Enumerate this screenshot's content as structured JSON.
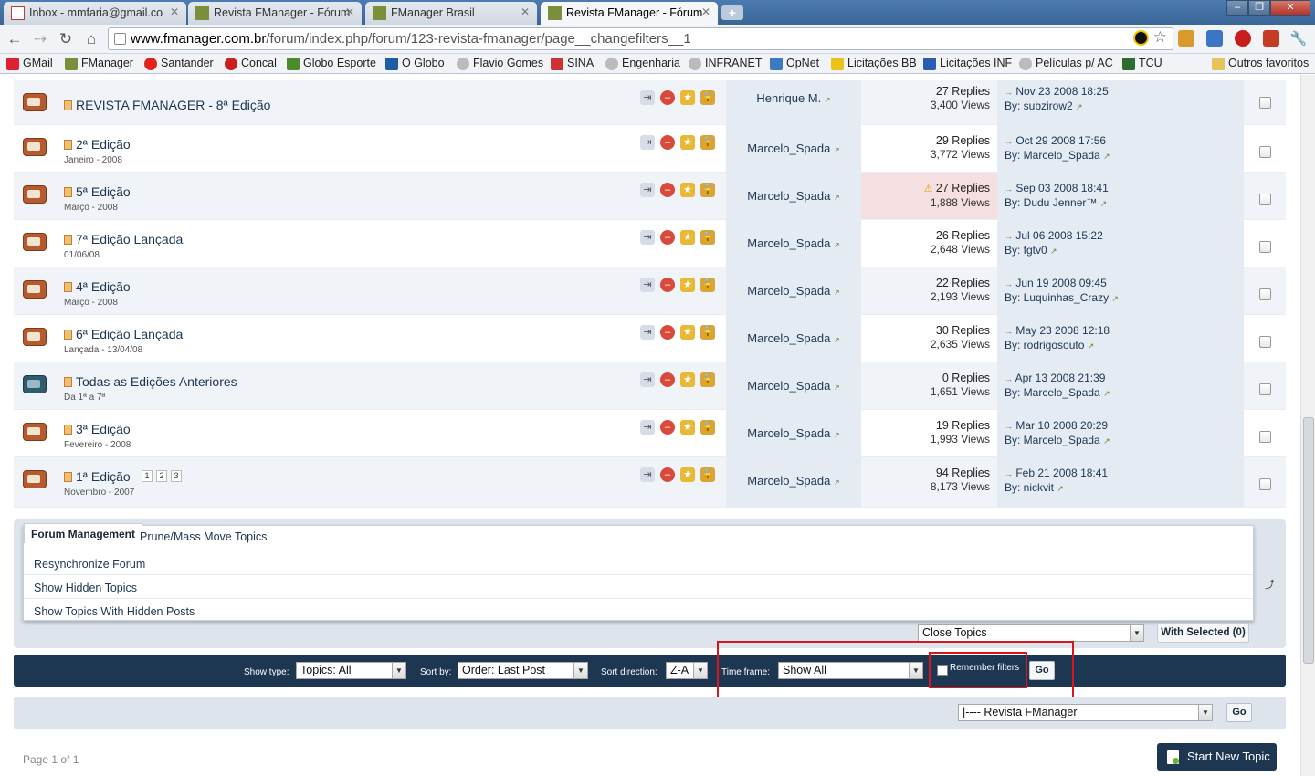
{
  "browser": {
    "tabs": [
      {
        "label": "Inbox - mmfaria@gmail.co"
      },
      {
        "label": "Revista FManager - Fórum"
      },
      {
        "label": "FManager Brasil"
      },
      {
        "label": "Revista FManager - Fórum"
      }
    ],
    "new_tab": "+",
    "url_domain": "www.fmanager.com.br",
    "url_path": "/forum/index.php/forum/123-revista-fmanager/page__changefilters__1",
    "bookmarks": [
      "GMail",
      "FManager",
      "Santander",
      "Concal",
      "Globo Esporte",
      "O Globo",
      "Flavio Gomes",
      "SINA",
      "Engenharia",
      "INFRANET",
      "OpNet",
      "Licitações BB",
      "Licitações INF",
      "Películas p/ AC",
      "TCU"
    ],
    "other_bookmarks": "Outros favoritos"
  },
  "topics": [
    {
      "title": "REVISTA FMANAGER - 8ª Edição",
      "desc": "",
      "starter": "Henrique M.",
      "replies": "27 Replies",
      "views": "3,400 Views",
      "last_date": "Nov 23 2008 18:25",
      "last_by": "By: subzirow2",
      "hot": false,
      "icon": "folder"
    },
    {
      "title": "2ª Edição",
      "desc": "Janeiro - 2008",
      "starter": "Marcelo_Spada",
      "replies": "29 Replies",
      "views": "3,772 Views",
      "last_date": "Oct 29 2008 17:56",
      "last_by": "By: Marcelo_Spada",
      "hot": false,
      "icon": "folder"
    },
    {
      "title": "5ª Edição",
      "desc": "Março - 2008",
      "starter": "Marcelo_Spada",
      "replies": "27 Replies",
      "views": "1,888 Views",
      "last_date": "Sep 03 2008 18:41",
      "last_by": "By: Dudu Jenner™",
      "hot": true,
      "icon": "folder"
    },
    {
      "title": "7ª Edição Lançada",
      "desc": "01/06/08",
      "starter": "Marcelo_Spada",
      "replies": "26 Replies",
      "views": "2,648 Views",
      "last_date": "Jul 06 2008 15:22",
      "last_by": "By: fgtv0",
      "hot": false,
      "icon": "folder"
    },
    {
      "title": "4ª Edição",
      "desc": "Março - 2008",
      "starter": "Marcelo_Spada",
      "replies": "22 Replies",
      "views": "2,193 Views",
      "last_date": "Jun 19 2008 09:45",
      "last_by": "By: Luquinhas_Crazy",
      "hot": false,
      "icon": "folder"
    },
    {
      "title": "6ª Edição Lançada",
      "desc": "Lançada - 13/04/08",
      "starter": "Marcelo_Spada",
      "replies": "30 Replies",
      "views": "2,635 Views",
      "last_date": "May 23 2008 12:18",
      "last_by": "By: rodrigosouto",
      "hot": false,
      "icon": "folder"
    },
    {
      "title": "Todas as Edições Anteriores",
      "desc": "Da 1ª a 7ª",
      "starter": "Marcelo_Spada",
      "replies": "0 Replies",
      "views": "1,651 Views",
      "last_date": "Apr 13 2008 21:39",
      "last_by": "By: Marcelo_Spada",
      "hot": false,
      "icon": "folder-teal"
    },
    {
      "title": "3ª Edição",
      "desc": "Fevereiro - 2008",
      "starter": "Marcelo_Spada",
      "replies": "19 Replies",
      "views": "1,993 Views",
      "last_date": "Mar 10 2008 20:29",
      "last_by": "By: Marcelo_Spada",
      "hot": false,
      "icon": "folder"
    },
    {
      "title": "1ª Edição",
      "desc": "Novembro - 2007",
      "starter": "Marcelo_Spada",
      "replies": "94 Replies",
      "views": "8,173 Views",
      "last_date": "Feb 21 2008 18:41",
      "last_by": "By: nickvit",
      "hot": false,
      "icon": "folder",
      "pages": [
        "1",
        "2",
        "3"
      ]
    }
  ],
  "management": {
    "tab_active": "Forum Management",
    "tab_other": "Prune/Mass Move Topics",
    "items": [
      "Resynchronize Forum",
      "Show Hidden Topics",
      "Show Topics With Hidden Posts"
    ],
    "selected_action": "Close Topics",
    "with_selected": "With Selected (0)"
  },
  "filters": {
    "show_type_label": "Show type:",
    "show_type_value": "Topics: All",
    "sort_by_label": "Sort by:",
    "sort_by_value": "Order: Last Post",
    "sort_dir_label": "Sort direction:",
    "sort_dir_value": "Z-A",
    "time_frame_label": "Time frame:",
    "time_frame_value": "Show All",
    "remember_label": "Remember filters",
    "go": "Go"
  },
  "jump": {
    "forum_value": "|---- Revista FManager",
    "go": "Go"
  },
  "footer": {
    "page_info": "Page 1 of 1",
    "new_topic": "Start New Topic"
  },
  "colors": {
    "accent": "#1d3652",
    "highlight": "#d9161e",
    "hot": "#f6dfe0"
  }
}
